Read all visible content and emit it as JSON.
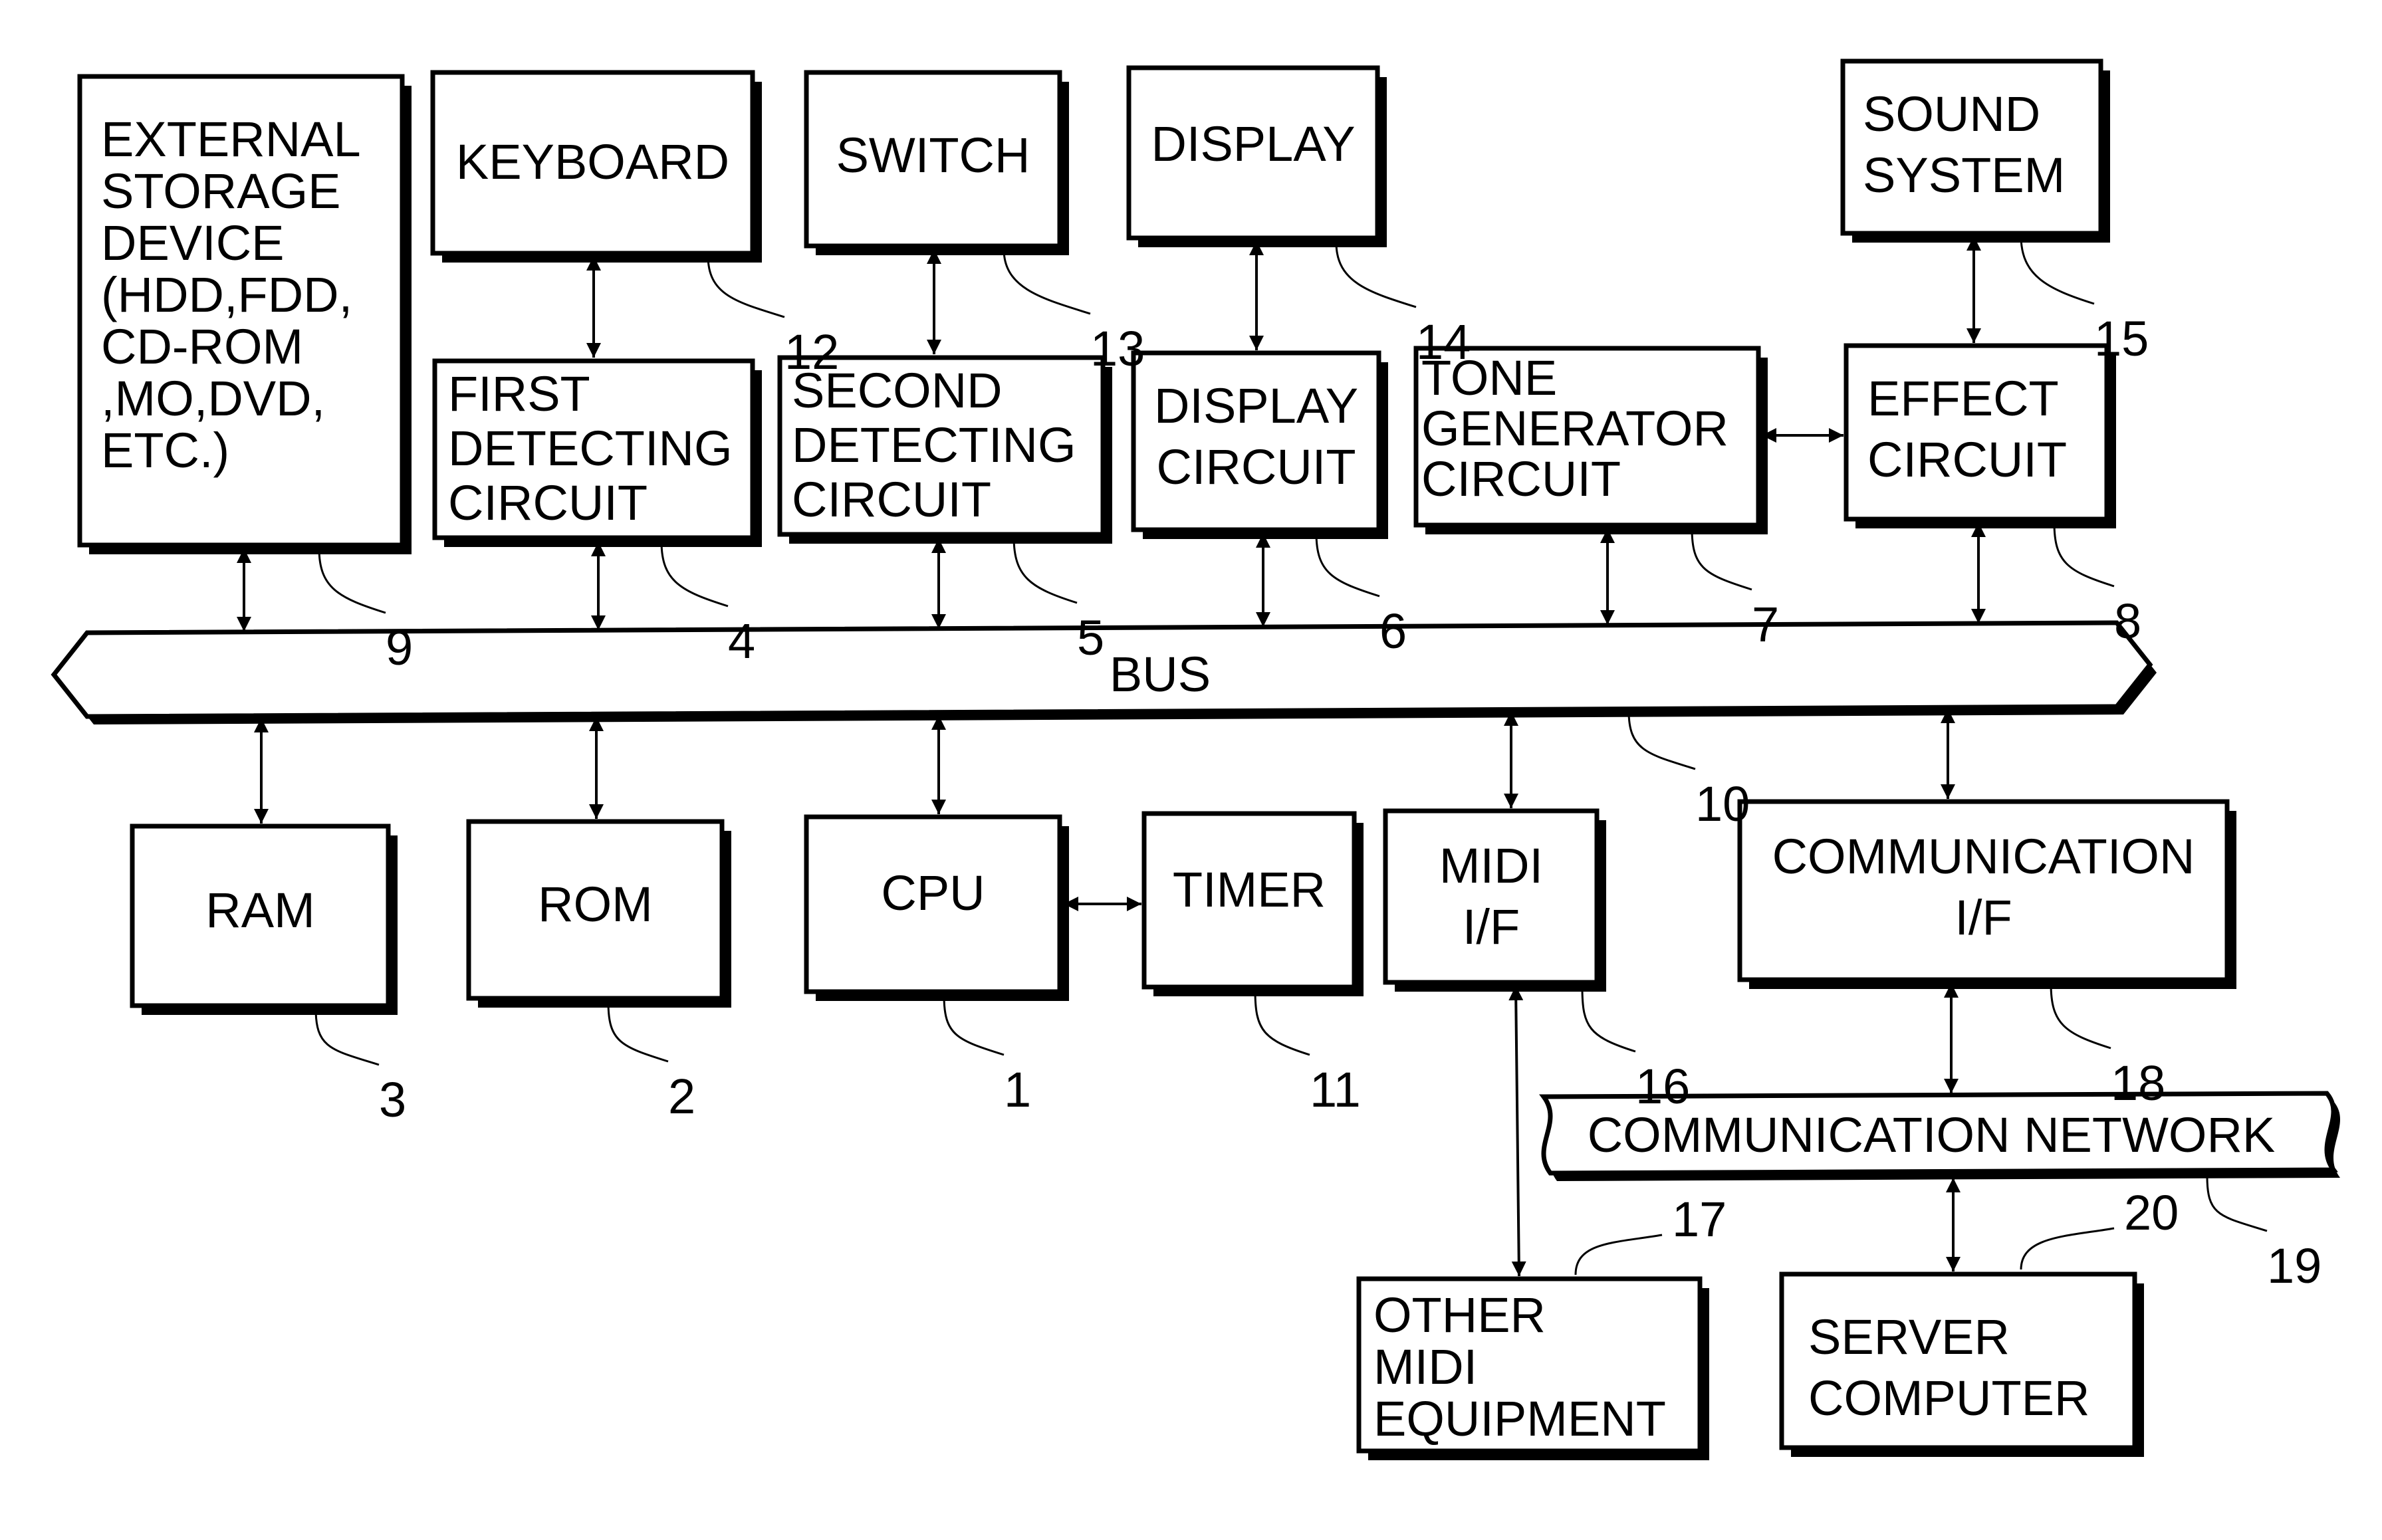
{
  "figure": {
    "blocks": {
      "external_storage": {
        "ref": "9",
        "lines": [
          "EXTERNAL",
          "STORAGE",
          "DEVICE",
          "(HDD,FDD,",
          "CD-ROM",
          ",MO,DVD,",
          "ETC.)"
        ]
      },
      "keyboard": {
        "ref": "12",
        "lines": [
          "KEYBOARD"
        ]
      },
      "switch": {
        "ref": "13",
        "lines": [
          "SWITCH"
        ]
      },
      "display": {
        "ref": "14",
        "lines": [
          "DISPLAY"
        ]
      },
      "sound_system": {
        "ref": "15",
        "lines": [
          "SOUND",
          "SYSTEM"
        ]
      },
      "first_detecting": {
        "ref": "4",
        "lines": [
          "FIRST",
          "DETECTING",
          "CIRCUIT"
        ]
      },
      "second_detecting": {
        "ref": "5",
        "lines": [
          "SECOND",
          "DETECTING",
          "CIRCUIT"
        ]
      },
      "display_circuit": {
        "ref": "6",
        "lines": [
          "DISPLAY",
          "CIRCUIT"
        ]
      },
      "tone_generator": {
        "ref": "7",
        "lines": [
          "TONE",
          "GENERATOR",
          "CIRCUIT"
        ]
      },
      "effect_circuit": {
        "ref": "8",
        "lines": [
          "EFFECT",
          "CIRCUIT"
        ]
      },
      "bus": {
        "ref": "10",
        "lines": [
          "BUS"
        ]
      },
      "ram": {
        "ref": "3",
        "lines": [
          "RAM"
        ]
      },
      "rom": {
        "ref": "2",
        "lines": [
          "ROM"
        ]
      },
      "cpu": {
        "ref": "1",
        "lines": [
          "CPU"
        ]
      },
      "timer": {
        "ref": "11",
        "lines": [
          "TIMER"
        ]
      },
      "midi_if": {
        "ref": "16",
        "lines": [
          "MIDI",
          "I/F"
        ]
      },
      "communication_if": {
        "ref": "18",
        "lines": [
          "COMMUNICATION",
          "I/F"
        ]
      },
      "communication_network": {
        "ref": "19",
        "lines": [
          "COMMUNICATION NETWORK"
        ]
      },
      "other_midi": {
        "ref": "17",
        "lines": [
          "OTHER",
          "MIDI",
          "EQUIPMENT"
        ]
      },
      "server_computer": {
        "ref": "20",
        "lines": [
          "SERVER",
          "COMPUTER"
        ]
      }
    },
    "connections": [
      [
        "keyboard",
        "first_detecting"
      ],
      [
        "switch",
        "second_detecting"
      ],
      [
        "display",
        "display_circuit"
      ],
      [
        "sound_system",
        "effect_circuit"
      ],
      [
        "tone_generator",
        "effect_circuit"
      ],
      [
        "external_storage",
        "bus"
      ],
      [
        "first_detecting",
        "bus"
      ],
      [
        "second_detecting",
        "bus"
      ],
      [
        "display_circuit",
        "bus"
      ],
      [
        "tone_generator",
        "bus"
      ],
      [
        "effect_circuit",
        "bus"
      ],
      [
        "bus",
        "ram"
      ],
      [
        "bus",
        "rom"
      ],
      [
        "bus",
        "cpu"
      ],
      [
        "cpu",
        "timer"
      ],
      [
        "bus",
        "midi_if"
      ],
      [
        "bus",
        "communication_if"
      ],
      [
        "midi_if",
        "other_midi"
      ],
      [
        "communication_if",
        "communication_network"
      ],
      [
        "communication_network",
        "server_computer"
      ]
    ]
  }
}
